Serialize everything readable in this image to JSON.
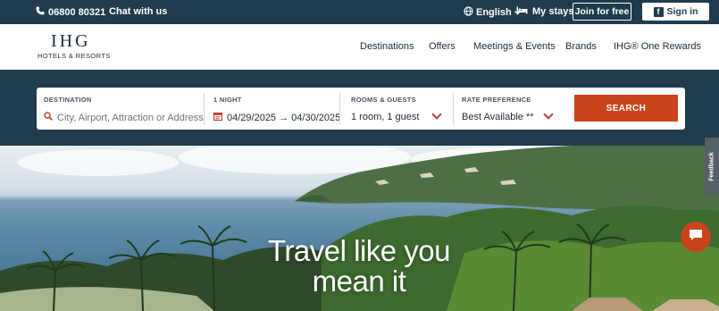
{
  "topbar": {
    "phone": "06800 80321",
    "chat": "Chat with us",
    "language": "English",
    "my_stays": "My stays",
    "join": "Join for free",
    "sign_in": "Sign in"
  },
  "logo": {
    "big": "IHG",
    "small": "HOTELS & RESORTS"
  },
  "nav": [
    "Destinations",
    "Offers",
    "Meetings & Events",
    "Brands",
    "IHG® One Rewards"
  ],
  "search": {
    "destination_label": "DESTINATION",
    "destination_placeholder": "City, Airport, Attraction or Address",
    "nights_label": "1 NIGHT",
    "dates": "04/29/2025 → 04/30/2025",
    "rooms_label": "ROOMS & GUESTS",
    "rooms_value": "1 room, 1 guest",
    "rate_label": "RATE PREFERENCE",
    "rate_value": "Best Available **",
    "button": "SEARCH"
  },
  "hero": {
    "line1": "Travel like you",
    "line2": "mean it"
  },
  "feedback": "Feedback",
  "colors": {
    "navy": "#1f3b4d",
    "accent": "#c9441c"
  },
  "icons": [
    "phone-icon",
    "globe-icon",
    "bed-icon",
    "facebook-icon",
    "search-icon",
    "calendar-icon",
    "chat-icon"
  ]
}
